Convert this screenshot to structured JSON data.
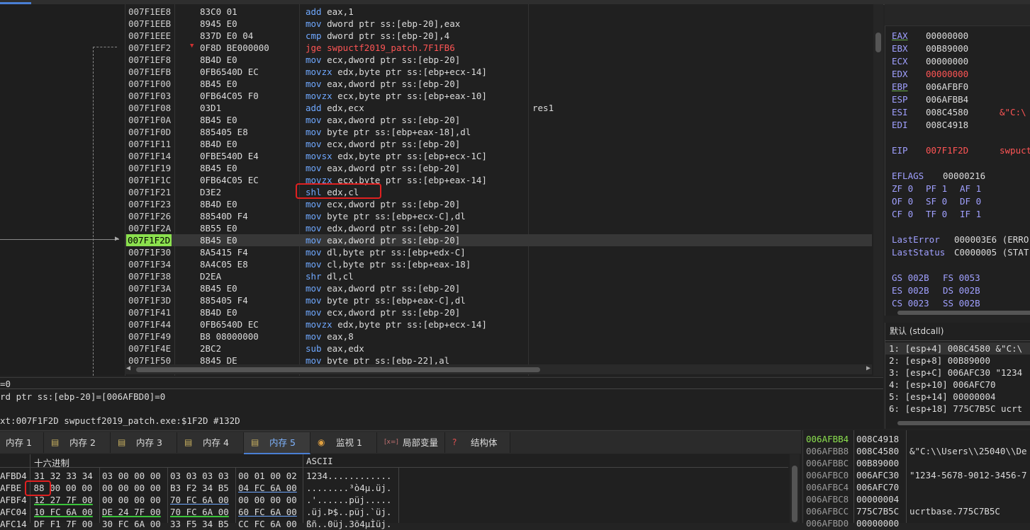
{
  "disasm": {
    "rows": [
      {
        "addr": "007F1EE8",
        "bytes": "83C0 01",
        "mn": "add",
        "ops": "eax,1",
        "cls": "blue",
        "cmt": ""
      },
      {
        "addr": "007F1EEB",
        "bytes": "8945 E0",
        "mn": "mov",
        "ops": "dword ptr ss:[ebp-20],eax",
        "cls": "blue",
        "cmt": ""
      },
      {
        "addr": "007F1EEE",
        "bytes": "837D E0 04",
        "mn": "cmp",
        "ops": "dword ptr ss:[ebp-20],4",
        "cls": "blue",
        "cmt": ""
      },
      {
        "addr": "007F1EF2",
        "bytes": "0F8D BE000000",
        "mn": "jge",
        "ops": "swpuctf2019_patch.7F1FB6",
        "cls": "red",
        "cmt": ""
      },
      {
        "addr": "007F1EF8",
        "bytes": "8B4D E0",
        "mn": "mov",
        "ops": "ecx,dword ptr ss:[ebp-20]",
        "cls": "blue",
        "cmt": ""
      },
      {
        "addr": "007F1EFB",
        "bytes": "0FB6540D EC",
        "mn": "movzx",
        "ops": "edx,byte ptr ss:[ebp+ecx-14]",
        "cls": "blue",
        "cmt": ""
      },
      {
        "addr": "007F1F00",
        "bytes": "8B45 E0",
        "mn": "mov",
        "ops": "eax,dword ptr ss:[ebp-20]",
        "cls": "blue",
        "cmt": ""
      },
      {
        "addr": "007F1F03",
        "bytes": "0FB64C05 F0",
        "mn": "movzx",
        "ops": "ecx,byte ptr ss:[ebp+eax-10]",
        "cls": "blue",
        "cmt": ""
      },
      {
        "addr": "007F1F08",
        "bytes": "03D1",
        "mn": "add",
        "ops": "edx,ecx",
        "cls": "blue",
        "cmt": "res1"
      },
      {
        "addr": "007F1F0A",
        "bytes": "8B45 E0",
        "mn": "mov",
        "ops": "eax,dword ptr ss:[ebp-20]",
        "cls": "blue",
        "cmt": ""
      },
      {
        "addr": "007F1F0D",
        "bytes": "885405 E8",
        "mn": "mov",
        "ops": "byte ptr ss:[ebp+eax-18],dl",
        "cls": "blue",
        "cmt": ""
      },
      {
        "addr": "007F1F11",
        "bytes": "8B4D E0",
        "mn": "mov",
        "ops": "ecx,dword ptr ss:[ebp-20]",
        "cls": "blue",
        "cmt": ""
      },
      {
        "addr": "007F1F14",
        "bytes": "0FBE540D E4",
        "mn": "movsx",
        "ops": "edx,byte ptr ss:[ebp+ecx-1C]",
        "cls": "blue",
        "cmt": ""
      },
      {
        "addr": "007F1F19",
        "bytes": "8B45 E0",
        "mn": "mov",
        "ops": "eax,dword ptr ss:[ebp-20]",
        "cls": "blue",
        "cmt": ""
      },
      {
        "addr": "007F1F1C",
        "bytes": "0FB64C05 EC",
        "mn": "movzx",
        "ops": "ecx,byte ptr ss:[ebp+eax-14]",
        "cls": "blue",
        "cmt": ""
      },
      {
        "addr": "007F1F21",
        "bytes": "D3E2",
        "mn": "shl",
        "ops": "edx,cl",
        "cls": "blue",
        "cmt": ""
      },
      {
        "addr": "007F1F23",
        "bytes": "8B4D E0",
        "mn": "mov",
        "ops": "ecx,dword ptr ss:[ebp-20]",
        "cls": "blue",
        "cmt": ""
      },
      {
        "addr": "007F1F26",
        "bytes": "88540D F4",
        "mn": "mov",
        "ops": "byte ptr ss:[ebp+ecx-C],dl",
        "cls": "blue",
        "cmt": ""
      },
      {
        "addr": "007F1F2A",
        "bytes": "8B55 E0",
        "mn": "mov",
        "ops": "edx,dword ptr ss:[ebp-20]",
        "cls": "blue",
        "cmt": ""
      },
      {
        "addr": "007F1F2D",
        "bytes": "8B45 E0",
        "mn": "mov",
        "ops": "eax,dword ptr ss:[ebp-20]",
        "cls": "blue",
        "cmt": "",
        "current": true
      },
      {
        "addr": "007F1F30",
        "bytes": "8A5415 F4",
        "mn": "mov",
        "ops": "dl,byte ptr ss:[ebp+edx-C]",
        "cls": "blue",
        "cmt": ""
      },
      {
        "addr": "007F1F34",
        "bytes": "8A4C05 E8",
        "mn": "mov",
        "ops": "cl,byte ptr ss:[ebp+eax-18]",
        "cls": "blue",
        "cmt": ""
      },
      {
        "addr": "007F1F38",
        "bytes": "D2EA",
        "mn": "shr",
        "ops": "dl,cl",
        "cls": "blue",
        "cmt": ""
      },
      {
        "addr": "007F1F3A",
        "bytes": "8B45 E0",
        "mn": "mov",
        "ops": "eax,dword ptr ss:[ebp-20]",
        "cls": "blue",
        "cmt": ""
      },
      {
        "addr": "007F1F3D",
        "bytes": "885405 F4",
        "mn": "mov",
        "ops": "byte ptr ss:[ebp+eax-C],dl",
        "cls": "blue",
        "cmt": ""
      },
      {
        "addr": "007F1F41",
        "bytes": "8B4D E0",
        "mn": "mov",
        "ops": "ecx,dword ptr ss:[ebp-20]",
        "cls": "blue",
        "cmt": ""
      },
      {
        "addr": "007F1F44",
        "bytes": "0FB6540D EC",
        "mn": "movzx",
        "ops": "edx,byte ptr ss:[ebp+ecx-14]",
        "cls": "blue",
        "cmt": ""
      },
      {
        "addr": "007F1F49",
        "bytes": "B8 08000000",
        "mn": "mov",
        "ops": "eax,8",
        "cls": "blue",
        "cmt": ""
      },
      {
        "addr": "007F1F4E",
        "bytes": "2BC2",
        "mn": "sub",
        "ops": "eax,edx",
        "cls": "blue",
        "cmt": ""
      },
      {
        "addr": "007F1F50",
        "bytes": "8845 DE",
        "mn": "mov",
        "ops": "byte ptr ss:[ebp-22],al",
        "cls": "blue",
        "cmt": ""
      }
    ]
  },
  "registers": {
    "general": [
      {
        "name": "EAX",
        "val": "00000000",
        "changed": false,
        "underline": true,
        "str": ""
      },
      {
        "name": "EBX",
        "val": "00B89000",
        "changed": false,
        "underline": false,
        "str": ""
      },
      {
        "name": "ECX",
        "val": "00000000",
        "changed": false,
        "underline": false,
        "str": ""
      },
      {
        "name": "EDX",
        "val": "00000000",
        "changed": true,
        "underline": false,
        "str": ""
      },
      {
        "name": "EBP",
        "val": "006AFBF0",
        "changed": false,
        "underline": true,
        "str": ""
      },
      {
        "name": "ESP",
        "val": "006AFBB4",
        "changed": false,
        "underline": false,
        "str": ""
      },
      {
        "name": "ESI",
        "val": "008C4580",
        "changed": false,
        "underline": false,
        "str": "&\"C:\\"
      },
      {
        "name": "EDI",
        "val": "008C4918",
        "changed": false,
        "underline": false,
        "str": ""
      }
    ],
    "eip": {
      "name": "EIP",
      "val": "007F1F2D",
      "str": "swpuct"
    },
    "eflags": {
      "name": "EFLAGS",
      "val": "00000216"
    },
    "flags": [
      [
        "ZF 0",
        "PF 1",
        "AF 1"
      ],
      [
        "OF 0",
        "SF 0",
        "DF 0"
      ],
      [
        "CF 0",
        "TF 0",
        "IF 1"
      ]
    ],
    "last_error": {
      "name": "LastError",
      "val": "000003E6 (ERRO"
    },
    "last_status": {
      "name": "LastStatus",
      "val": "C0000005 (STAT"
    },
    "segments": [
      [
        "GS 002B",
        "FS 0053"
      ],
      [
        "ES 002B",
        "DS 002B"
      ],
      [
        "CS 0023",
        "SS 002B"
      ]
    ]
  },
  "call_args": {
    "title": "默认 (stdcall)",
    "rows": [
      "1: [esp+4] 008C4580 &\"C:\\",
      "2: [esp+8] 00B89000",
      "3: [esp+C] 006AFC30 \"1234",
      "4: [esp+10] 006AFC70",
      "5: [esp+14] 00000004",
      "6: [esp+18] 775C7B5C ucrt"
    ]
  },
  "info": {
    "line1": "=0",
    "line2": "rd ptr ss:[ebp-20]=[006AFBD0]=0",
    "line3": "",
    "line4": "xt:007F1F2D swpuctf2019_patch.exe:$1F2D #132D"
  },
  "dump_tabs": [
    {
      "label": "内存 1",
      "icon": "memory-icon",
      "active": false
    },
    {
      "label": "内存 2",
      "icon": "memory-icon",
      "active": false
    },
    {
      "label": "内存 3",
      "icon": "memory-icon",
      "active": false
    },
    {
      "label": "内存 4",
      "icon": "memory-icon",
      "active": false
    },
    {
      "label": "内存 5",
      "icon": "memory-icon",
      "active": true
    },
    {
      "label": "监视 1",
      "icon": "watch-icon",
      "active": false
    },
    {
      "label": "局部变量",
      "icon": "locals-icon",
      "active": false
    },
    {
      "label": "结构体",
      "icon": "struct-icon",
      "active": false
    }
  ],
  "dump": {
    "hex_header": "十六进制",
    "ascii_header": "ASCII",
    "rows": [
      {
        "addr": "AFBD4",
        "g1": "31 32 33 34",
        "g2": "03 00 00 00",
        "g3": "03 03 03 03",
        "g4": "00 01 00 02",
        "ascii": "1234............"
      },
      {
        "addr": "AFBE",
        "g1": " 88 00 00 00",
        "g2": "00 00 00 00",
        "g3": "B3 F2 34 B5",
        "g4": "04 FC 6A 00",
        "ascii": "........³ò4µ.üj."
      },
      {
        "addr": "AFBF4",
        "g1": "12 27 7F 00",
        "g2": "00 00 00 00",
        "g3": "70 FC 6A 00",
        "g4": "00 00 00 00",
        "ascii": ".'......püj....."
      },
      {
        "addr": "AFC04",
        "g1": "10 FC 6A 00",
        "g2": "DE 24 7F 00",
        "g3": "70 FC 6A 00",
        "g4": "60 FC 6A 00",
        "ascii": ".üj.Þ$..püj.`üj."
      },
      {
        "addr": "AFC14",
        "g1": "DF F1 7F 00",
        "g2": "30 FC 6A 00",
        "g3": "33 F5 34 B5",
        "g4": "CC FC 6A 00",
        "ascii": "ßñ..0üj.3õ4µÌüj."
      }
    ]
  },
  "stack": {
    "rows": [
      {
        "addr": "006AFBB4",
        "val": "008C4918",
        "cmt": "",
        "top": true
      },
      {
        "addr": "006AFBB8",
        "val": "008C4580",
        "cmt": "&\"C:\\\\Users\\\\25040\\\\De"
      },
      {
        "addr": "006AFBBC",
        "val": "00B89000",
        "cmt": ""
      },
      {
        "addr": "006AFBC0",
        "val": "006AFC30",
        "cmt": "\"1234-5678-9012-3456-7"
      },
      {
        "addr": "006AFBC4",
        "val": "006AFC70",
        "cmt": ""
      },
      {
        "addr": "006AFBC8",
        "val": "00000004",
        "cmt": ""
      },
      {
        "addr": "006AFBCC",
        "val": "775C7B5C",
        "cmt": "ucrtbase.775C7B5C"
      },
      {
        "addr": "006AFBD0",
        "val": "00000000",
        "cmt": ""
      }
    ]
  }
}
